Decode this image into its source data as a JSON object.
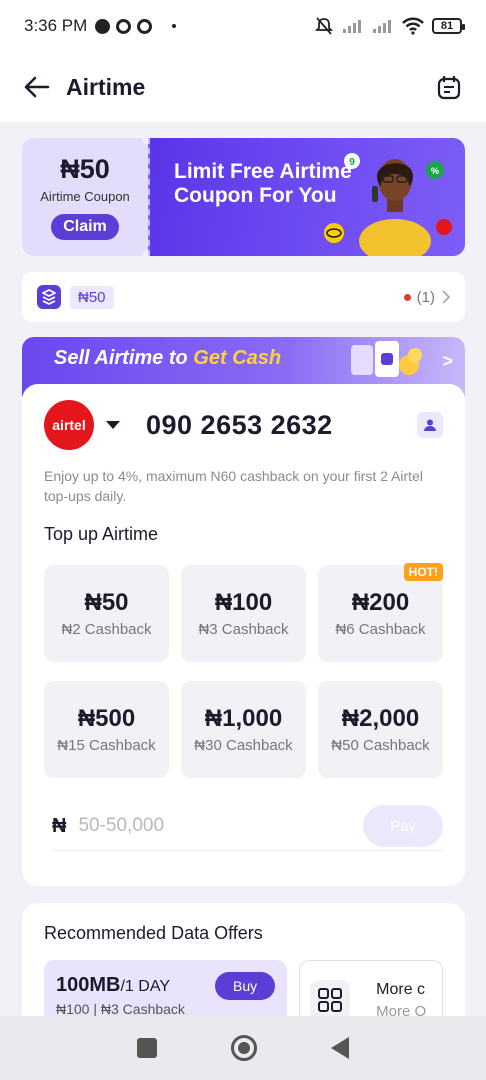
{
  "status_bar": {
    "time": "3:36 PM",
    "battery": "81"
  },
  "header": {
    "title": "Airtime"
  },
  "coupon_banner": {
    "amount": "₦50",
    "label": "Airtime Coupon",
    "claim": "Claim",
    "headline": "Limit Free Airtime Coupon For You"
  },
  "coupon_row": {
    "chip": "₦50",
    "count": "(1)"
  },
  "sell_banner": {
    "text_part1": "Sell Airtime to ",
    "text_highlight": "Get Cash"
  },
  "recharge": {
    "network_logo_text": "airtel",
    "phone": "090 2653 2632",
    "promo": "Enjoy up to 4%, maximum N60 cashback on your first 2 Airtel top-ups daily.",
    "section_title": "Top up Airtime",
    "hot_badge": "HOT!",
    "tiles": [
      {
        "amount": "₦50",
        "cashback": "₦2 Cashback"
      },
      {
        "amount": "₦100",
        "cashback": "₦3 Cashback"
      },
      {
        "amount": "₦200",
        "cashback": "₦6 Cashback"
      },
      {
        "amount": "₦500",
        "cashback": "₦15 Cashback"
      },
      {
        "amount": "₦1,000",
        "cashback": "₦30 Cashback"
      },
      {
        "amount": "₦2,000",
        "cashback": "₦50 Cashback"
      }
    ],
    "currency_symbol": "₦",
    "amount_placeholder": "50-50,000",
    "pay": "Pay"
  },
  "recommended": {
    "title": "Recommended Data Offers",
    "offer": {
      "size": "100MB",
      "period": "/1 DAY",
      "price": "₦100 | ₦3 Cashback",
      "buy": "Buy"
    },
    "more": {
      "title": "More c",
      "subtitle": "More O"
    }
  },
  "colors": {
    "brand": "#5b3ed6",
    "airtel_red": "#e4151b",
    "hot": "#ff9f1c"
  }
}
